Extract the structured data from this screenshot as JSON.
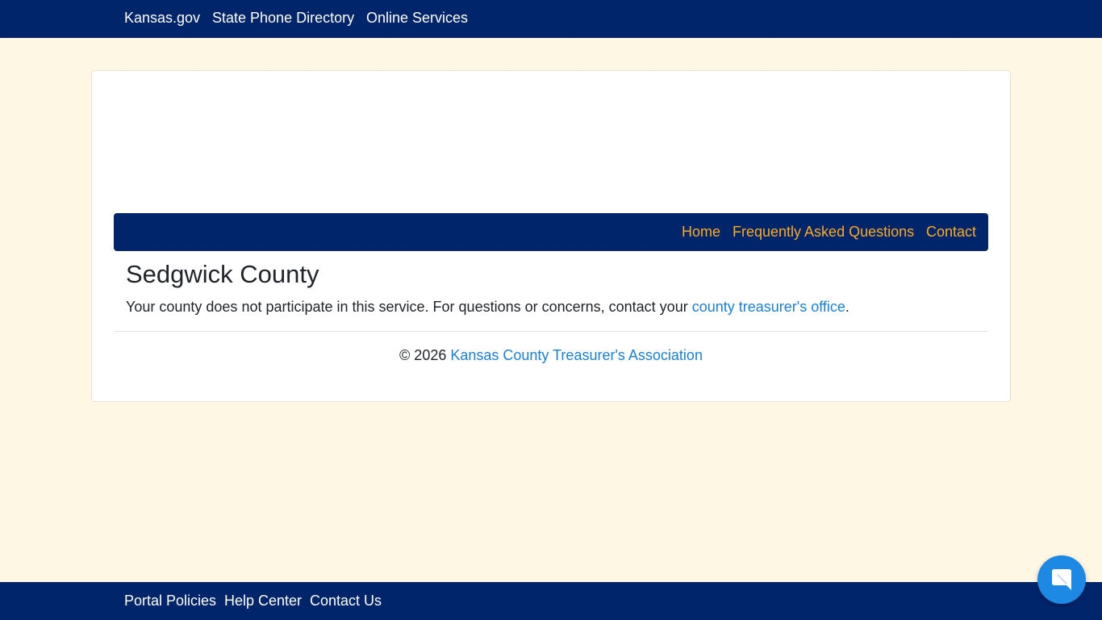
{
  "top_nav": {
    "links": [
      "Kansas.gov",
      "State Phone Directory",
      "Online Services"
    ]
  },
  "site_nav": {
    "links": [
      "Home",
      "Frequently Asked Questions",
      "Contact"
    ]
  },
  "main": {
    "county_title": "Sedgwick County",
    "message_text": "Your county does not participate in this service. For questions or concerns, contact your ",
    "message_link": "county treasurer's office",
    "message_end": "."
  },
  "footer": {
    "copyright": "© 2026 ",
    "association_link": "Kansas County Treasurer's Association"
  },
  "bottom_nav": {
    "links": [
      "Portal Policies",
      "Help Center",
      "Contact Us"
    ]
  },
  "chat": {
    "icon": "chat-bubble-icon"
  },
  "colors": {
    "brand_navy": "#00256a",
    "page_background": "#fef7e3",
    "nav_link_gold": "#f7ab23",
    "link_blue": "#1a7fdc",
    "chat_blue": "#1e88e5"
  }
}
